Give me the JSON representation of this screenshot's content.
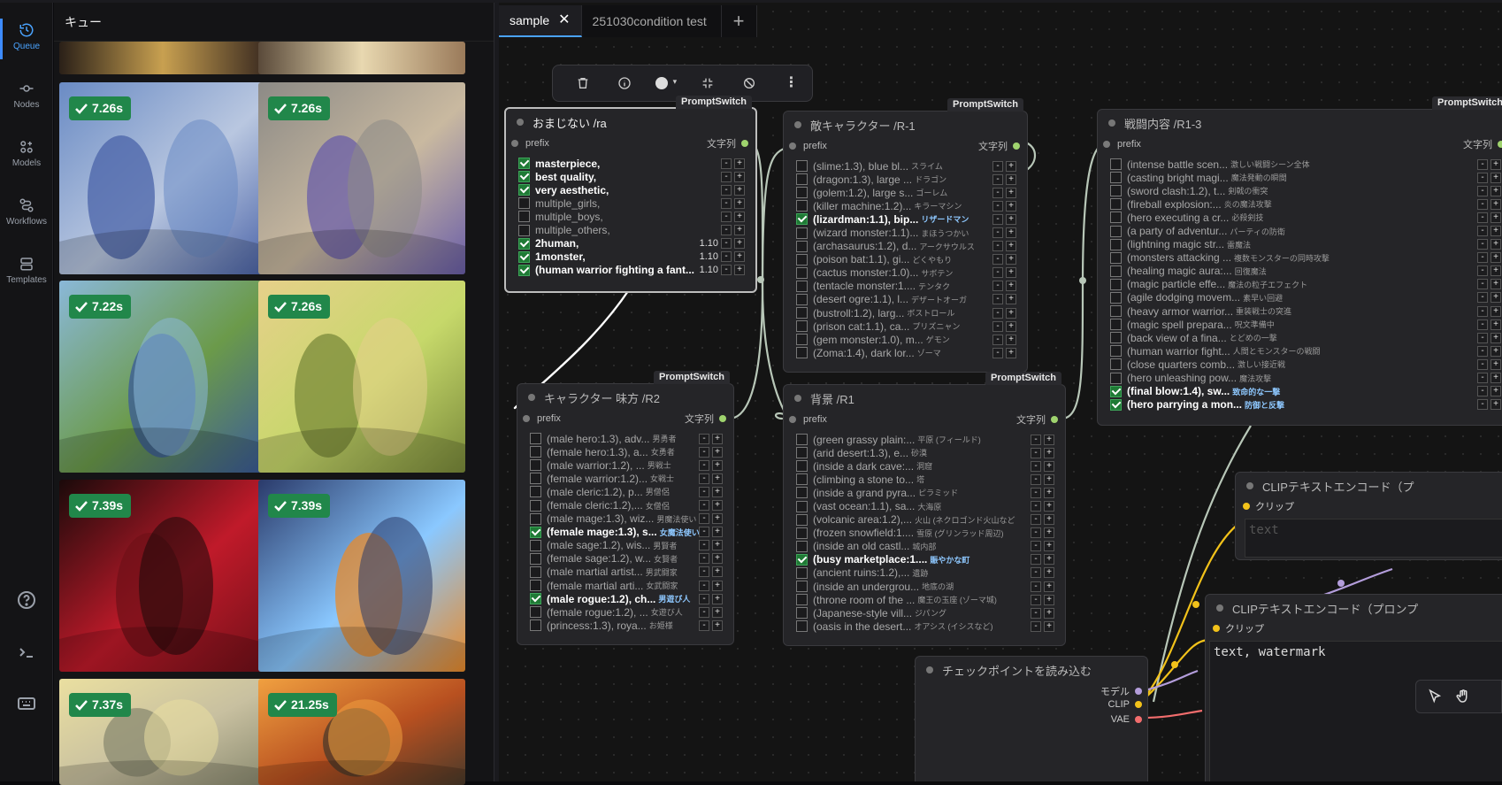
{
  "rail": {
    "items": [
      {
        "label": "Queue",
        "icon": "history-icon",
        "active": true
      },
      {
        "label": "Nodes",
        "icon": "nodes-icon"
      },
      {
        "label": "Models",
        "icon": "models-icon"
      },
      {
        "label": "Workflows",
        "icon": "workflows-icon"
      },
      {
        "label": "Templates",
        "icon": "templates-icon"
      }
    ],
    "bottom_icons": [
      "help-icon",
      "terminal-icon",
      "keyboard-icon"
    ]
  },
  "queue": {
    "title": "キュー",
    "items": [
      {
        "time": "7.26s",
        "palette": [
          "#6a8bc4",
          "#b9c7e0",
          "#4a63a8"
        ]
      },
      {
        "time": "7.26s",
        "palette": [
          "#8c8a86",
          "#c9b9a0",
          "#6a5ea8"
        ]
      },
      {
        "time": "7.22s",
        "palette": [
          "#8ab8d8",
          "#6b9a4a",
          "#3a5a9a"
        ]
      },
      {
        "time": "7.26s",
        "palette": [
          "#e6d08a",
          "#c6d86a",
          "#7a8a3a"
        ]
      },
      {
        "time": "7.39s",
        "palette": [
          "#1a0a0a",
          "#c01a2a",
          "#701018"
        ]
      },
      {
        "time": "7.39s",
        "palette": [
          "#2a3a6a",
          "#8ac8ff",
          "#e88a2a"
        ]
      },
      {
        "time": "7.37s",
        "palette": [
          "#eadfa0",
          "#c8c0a0",
          "#8a8a70"
        ]
      },
      {
        "time": "21.25s",
        "palette": [
          "#f0a040",
          "#b85020",
          "#4a3a2a"
        ]
      }
    ]
  },
  "tabs": [
    {
      "label": "sample",
      "active": true,
      "closable": true
    },
    {
      "label": "251030condition test"
    },
    {
      "label": "+"
    }
  ],
  "toolbar": {
    "icons": [
      "trash-icon",
      "info-icon",
      "color-dot-icon",
      "fit-icon",
      "bypass-icon",
      "more-icon"
    ]
  },
  "nodes": {
    "ra": {
      "title": "おまじない /ra",
      "tag": "PromptSwitch",
      "prefix": "prefix",
      "out": "文字列",
      "items": [
        {
          "t": "masterpiece,",
          "on": true
        },
        {
          "t": "best quality,",
          "on": true
        },
        {
          "t": "very aesthetic,",
          "on": true
        },
        {
          "t": "multiple_girls,",
          "on": false
        },
        {
          "t": "multiple_boys,",
          "on": false
        },
        {
          "t": "multiple_others,",
          "on": false
        },
        {
          "t": "2human,",
          "on": true,
          "w": "1.10"
        },
        {
          "t": "1monster,",
          "on": true,
          "w": "1.10"
        },
        {
          "t": "(human warrior fighting a fant...",
          "on": true,
          "w": "1.10"
        }
      ]
    },
    "r1": {
      "title": "敵キャラクター /R-1",
      "tag": "PromptSwitch",
      "prefix": "prefix",
      "out": "文字列",
      "items": [
        {
          "t": "(slime:1.3), blue bl...",
          "jp": "スライム"
        },
        {
          "t": "(dragon:1.3), large ...",
          "jp": "ドラゴン"
        },
        {
          "t": "(golem:1.2), large s...",
          "jp": "ゴーレム"
        },
        {
          "t": "(killer machine:1.2)...",
          "jp": "キラーマシン"
        },
        {
          "t": "(lizardman:1.1), bip...",
          "jp": "リザードマン",
          "on": true
        },
        {
          "t": "(wizard monster:1.1)...",
          "jp": "まほうつかい"
        },
        {
          "t": "(archasaurus:1.2), d...",
          "jp": "アークサウルス"
        },
        {
          "t": "(poison bat:1.1), gi...",
          "jp": "どくやもり"
        },
        {
          "t": "(cactus monster:1.0)...",
          "jp": "サボテン"
        },
        {
          "t": "(tentacle monster:1....",
          "jp": "テンタク"
        },
        {
          "t": "(desert ogre:1.1), l...",
          "jp": "デザートオーガ"
        },
        {
          "t": "(bustroll:1.2), larg...",
          "jp": "ボストロール"
        },
        {
          "t": "(prison cat:1.1), ca...",
          "jp": "プリズニャン"
        },
        {
          "t": "(gem monster:1.0), m...",
          "jp": "ゲモン"
        },
        {
          "t": "(Zoma:1.4), dark lor...",
          "jp": "ゾーマ"
        }
      ]
    },
    "r13": {
      "title": "戦闘内容 /R1-3",
      "tag": "PromptSwitch",
      "prefix": "prefix",
      "out": "文字列",
      "items": [
        {
          "t": "(intense battle scen...",
          "jp": "激しい戦闘シーン全体"
        },
        {
          "t": "(casting bright magi...",
          "jp": "魔法発動の瞬間"
        },
        {
          "t": "(sword clash:1.2), t...",
          "jp": "剣戟の衝突"
        },
        {
          "t": "(fireball explosion:...",
          "jp": "炎の魔法攻撃"
        },
        {
          "t": "(hero executing a cr...",
          "jp": "必殺剣技"
        },
        {
          "t": "(a party of adventur...",
          "jp": "パーティの防衛"
        },
        {
          "t": "(lightning magic str...",
          "jp": "雷魔法"
        },
        {
          "t": "(monsters attacking ...",
          "jp": "複数モンスターの同時攻撃"
        },
        {
          "t": "(healing magic aura:...",
          "jp": "回復魔法"
        },
        {
          "t": "(magic particle effe...",
          "jp": "魔法の粒子エフェクト"
        },
        {
          "t": "(agile dodging movem...",
          "jp": "素早い回避"
        },
        {
          "t": "(heavy armor warrior...",
          "jp": "重装戦士の突進"
        },
        {
          "t": "(magic spell prepara...",
          "jp": "呪文準備中"
        },
        {
          "t": "(back view of a fina...",
          "jp": "とどめの一撃"
        },
        {
          "t": "(human warrior fight...",
          "jp": "人間とモンスターの戦闘"
        },
        {
          "t": "(close quarters comb...",
          "jp": "激しい接近戦"
        },
        {
          "t": "(hero unleashing pow...",
          "jp": "魔法攻撃"
        },
        {
          "t": "(final blow:1.4), sw...",
          "jp": "致命的な一撃",
          "on": true
        },
        {
          "t": "(hero parrying a mon...",
          "jp": "防御と反撃",
          "on": true
        }
      ]
    },
    "r2": {
      "title": "キャラクター 味方 /R2",
      "tag": "PromptSwitch",
      "prefix": "prefix",
      "out": "文字列",
      "items": [
        {
          "t": "(male hero:1.3), adv...",
          "jp": "男勇者"
        },
        {
          "t": "(female hero:1.3), a...",
          "jp": "女勇者"
        },
        {
          "t": "(male warrior:1.2), ...",
          "jp": "男戦士"
        },
        {
          "t": "(female warrior:1.2)...",
          "jp": "女戦士"
        },
        {
          "t": "(male cleric:1.2), p...",
          "jp": "男僧侶"
        },
        {
          "t": "(female cleric:1.2),...",
          "jp": "女僧侶"
        },
        {
          "t": "(male mage:1.3), wiz...",
          "jp": "男魔法使い"
        },
        {
          "t": "(female mage:1.3), s...",
          "jp": "女魔法使い",
          "on": true
        },
        {
          "t": "(male sage:1.2), wis...",
          "jp": "男賢者"
        },
        {
          "t": "(female sage:1.2), w...",
          "jp": "女賢者"
        },
        {
          "t": "(male martial artist...",
          "jp": "男武闘家"
        },
        {
          "t": "(female martial arti...",
          "jp": "女武闘家"
        },
        {
          "t": "(male rogue:1.2), ch...",
          "jp": "男遊び人",
          "on": true
        },
        {
          "t": "(female rogue:1.2), ...",
          "jp": "女遊び人"
        },
        {
          "t": "(princess:1.3), roya...",
          "jp": "お姫様"
        }
      ]
    },
    "bg": {
      "title": "背景 /R1",
      "tag": "PromptSwitch",
      "prefix": "prefix",
      "out": "文字列",
      "items": [
        {
          "t": "(green grassy plain:...",
          "jp": "平原 (フィールド)"
        },
        {
          "t": "(arid desert:1.3), e...",
          "jp": "砂漠"
        },
        {
          "t": "(inside a dark cave:...",
          "jp": "洞窟"
        },
        {
          "t": "(climbing a stone to...",
          "jp": "塔"
        },
        {
          "t": "(inside a grand pyra...",
          "jp": "ピラミッド"
        },
        {
          "t": "(vast ocean:1.1), sa...",
          "jp": "大海原"
        },
        {
          "t": "(volcanic area:1.2),...",
          "jp": "火山 (ネクロゴンド火山など"
        },
        {
          "t": "(frozen snowfield:1....",
          "jp": "雪原 (グリンラッド周辺)"
        },
        {
          "t": "(inside an old castl...",
          "jp": "城内部"
        },
        {
          "t": "(busy marketplace:1....",
          "jp": "賑やかな町",
          "on": true
        },
        {
          "t": "(ancient ruins:1.2),...",
          "jp": "遺跡"
        },
        {
          "t": "(inside an undergrou...",
          "jp": "地底の湖"
        },
        {
          "t": "(throne room of the ...",
          "jp": "魔王の玉座 (ゾーマ城)"
        },
        {
          "t": "(Japanese-style vill...",
          "jp": "ジパング"
        },
        {
          "t": "(oasis in the desert...",
          "jp": "オアシス (イシスなど)"
        }
      ]
    },
    "clip1": {
      "title": "CLIPテキストエンコード（プ",
      "clip": "クリップ",
      "text_placeholder": "text"
    },
    "clip2": {
      "title": "CLIPテキストエンコード（プロンプ",
      "clip": "クリップ",
      "text": "text, watermark"
    },
    "ckpt": {
      "title": "チェックポイントを読み込む",
      "outs": [
        "モデル",
        "CLIP",
        "VAE"
      ]
    }
  },
  "colors": {
    "accent": "#3d8bff",
    "badge": "#21874a",
    "check": "#1f7a35",
    "link_clip": "#f2c21a",
    "link_model": "#b39ddb",
    "link_vae": "#f26d6d",
    "link_string": "#b8c7b8"
  }
}
